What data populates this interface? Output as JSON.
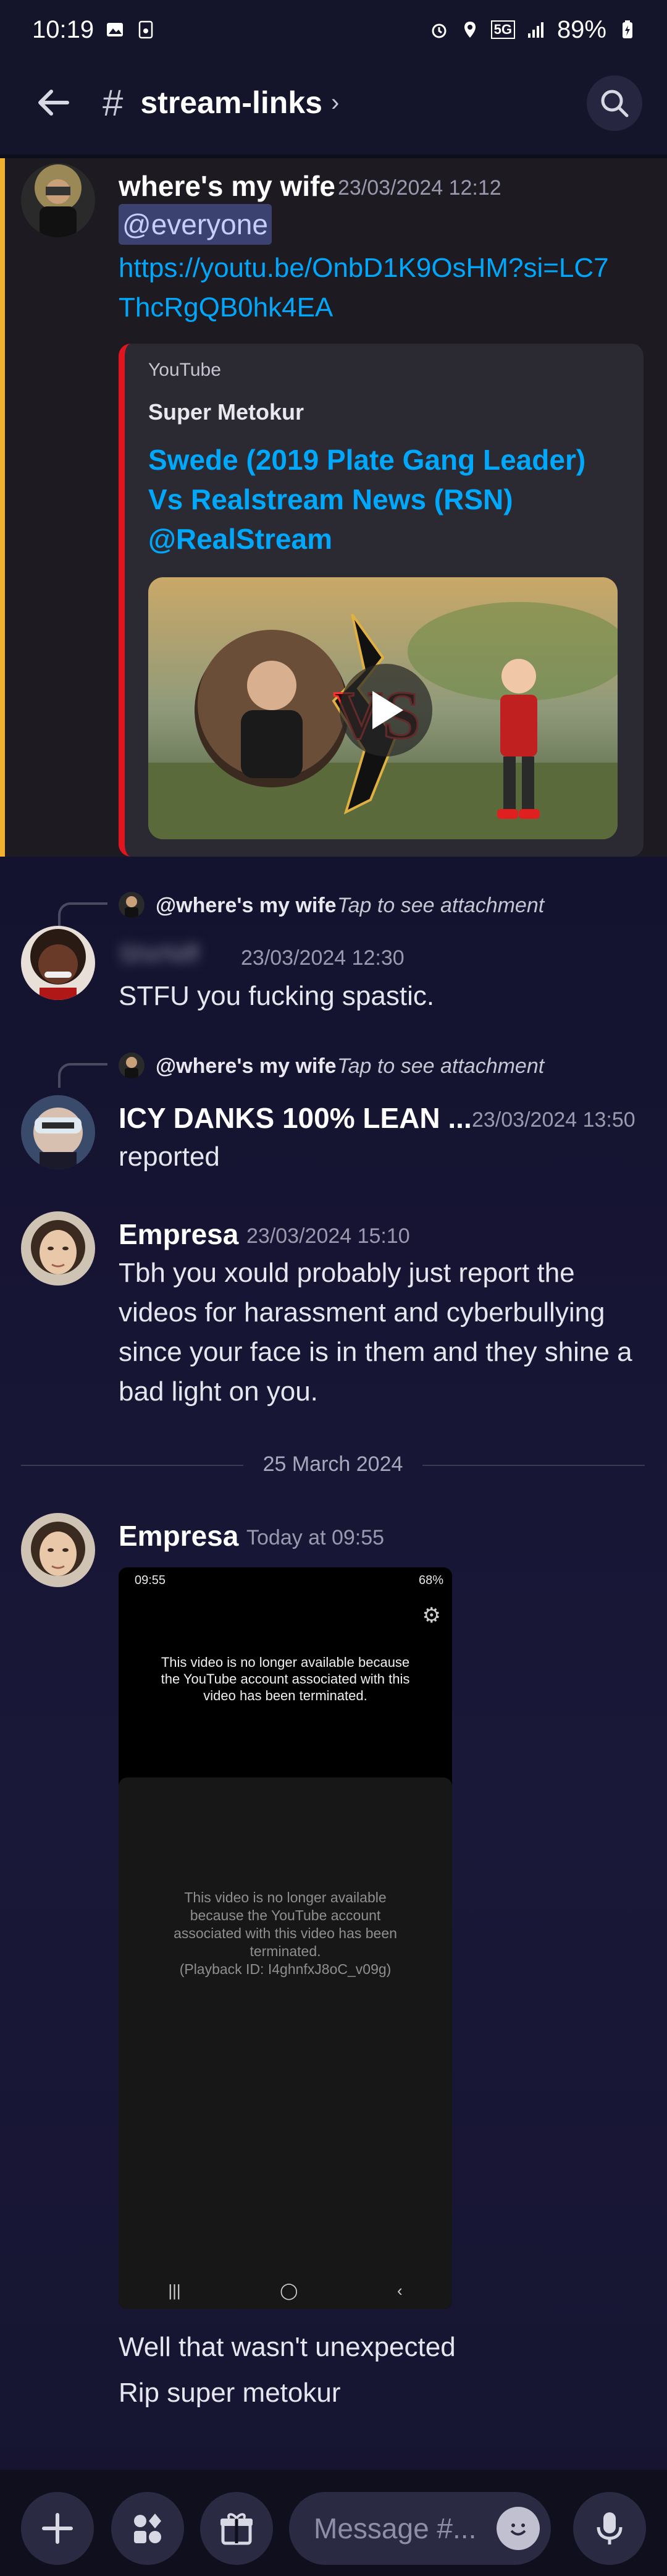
{
  "status_bar": {
    "time": "10:19",
    "network": "5G",
    "battery": "89%"
  },
  "header": {
    "channel_name": "stream-links",
    "chevron": "›",
    "hash": "#"
  },
  "messages": [
    {
      "author": "where's my wife",
      "timestamp": "23/03/2024 12:12",
      "mention": "@everyone",
      "link": "https://youtu.be/OnbD1K9OsHM?si=LC7ThcRgQB0hk4EA",
      "embed": {
        "provider": "YouTube",
        "author": "Super Metokur",
        "title": "Swede (2019 Plate Gang Leader) Vs Realstream News (RSN) @RealStream",
        "accent_color": "#e1151f"
      }
    },
    {
      "reply_to": "@where's my wife",
      "reply_hint": "Tap to see attachment",
      "author": "ShirNiff",
      "timestamp": "23/03/2024 12:30",
      "text": "STFU you fucking spastic."
    },
    {
      "reply_to": "@where's my wife",
      "reply_hint": "Tap to see attachment",
      "author": "ICY DANKS 100% LEAN ...",
      "timestamp": "23/03/2024 13:50",
      "text": "reported"
    },
    {
      "author": "Empresa",
      "timestamp": "23/03/2024 15:10",
      "text": "Tbh you xould probably just report the videos for harassment and cyberbullying since your face is in them and they shine a bad light on you."
    },
    {
      "author": "Empresa",
      "timestamp": "Today at 09:55",
      "attachment": {
        "status_time": "09:55",
        "status_battery": "68%",
        "notice": "This video is no longer available because the YouTube account associated with this video has been terminated.",
        "notice_detail": "This video is no longer available because the YouTube account associated with this video has been terminated.",
        "playback_id": "(Playback ID: I4ghnfxJ8oC_v09g)",
        "nav_recent": "|||",
        "nav_home": "◯",
        "nav_back": "‹"
      },
      "text_lines": [
        "Well that wasn't unexpected",
        "Rip super metokur"
      ]
    }
  ],
  "date_divider": "25 March 2024",
  "composer": {
    "placeholder": "Message #..."
  },
  "colors": {
    "mention_highlight": "#f0b132",
    "link": "#00a8fc",
    "background": "#14142a"
  }
}
